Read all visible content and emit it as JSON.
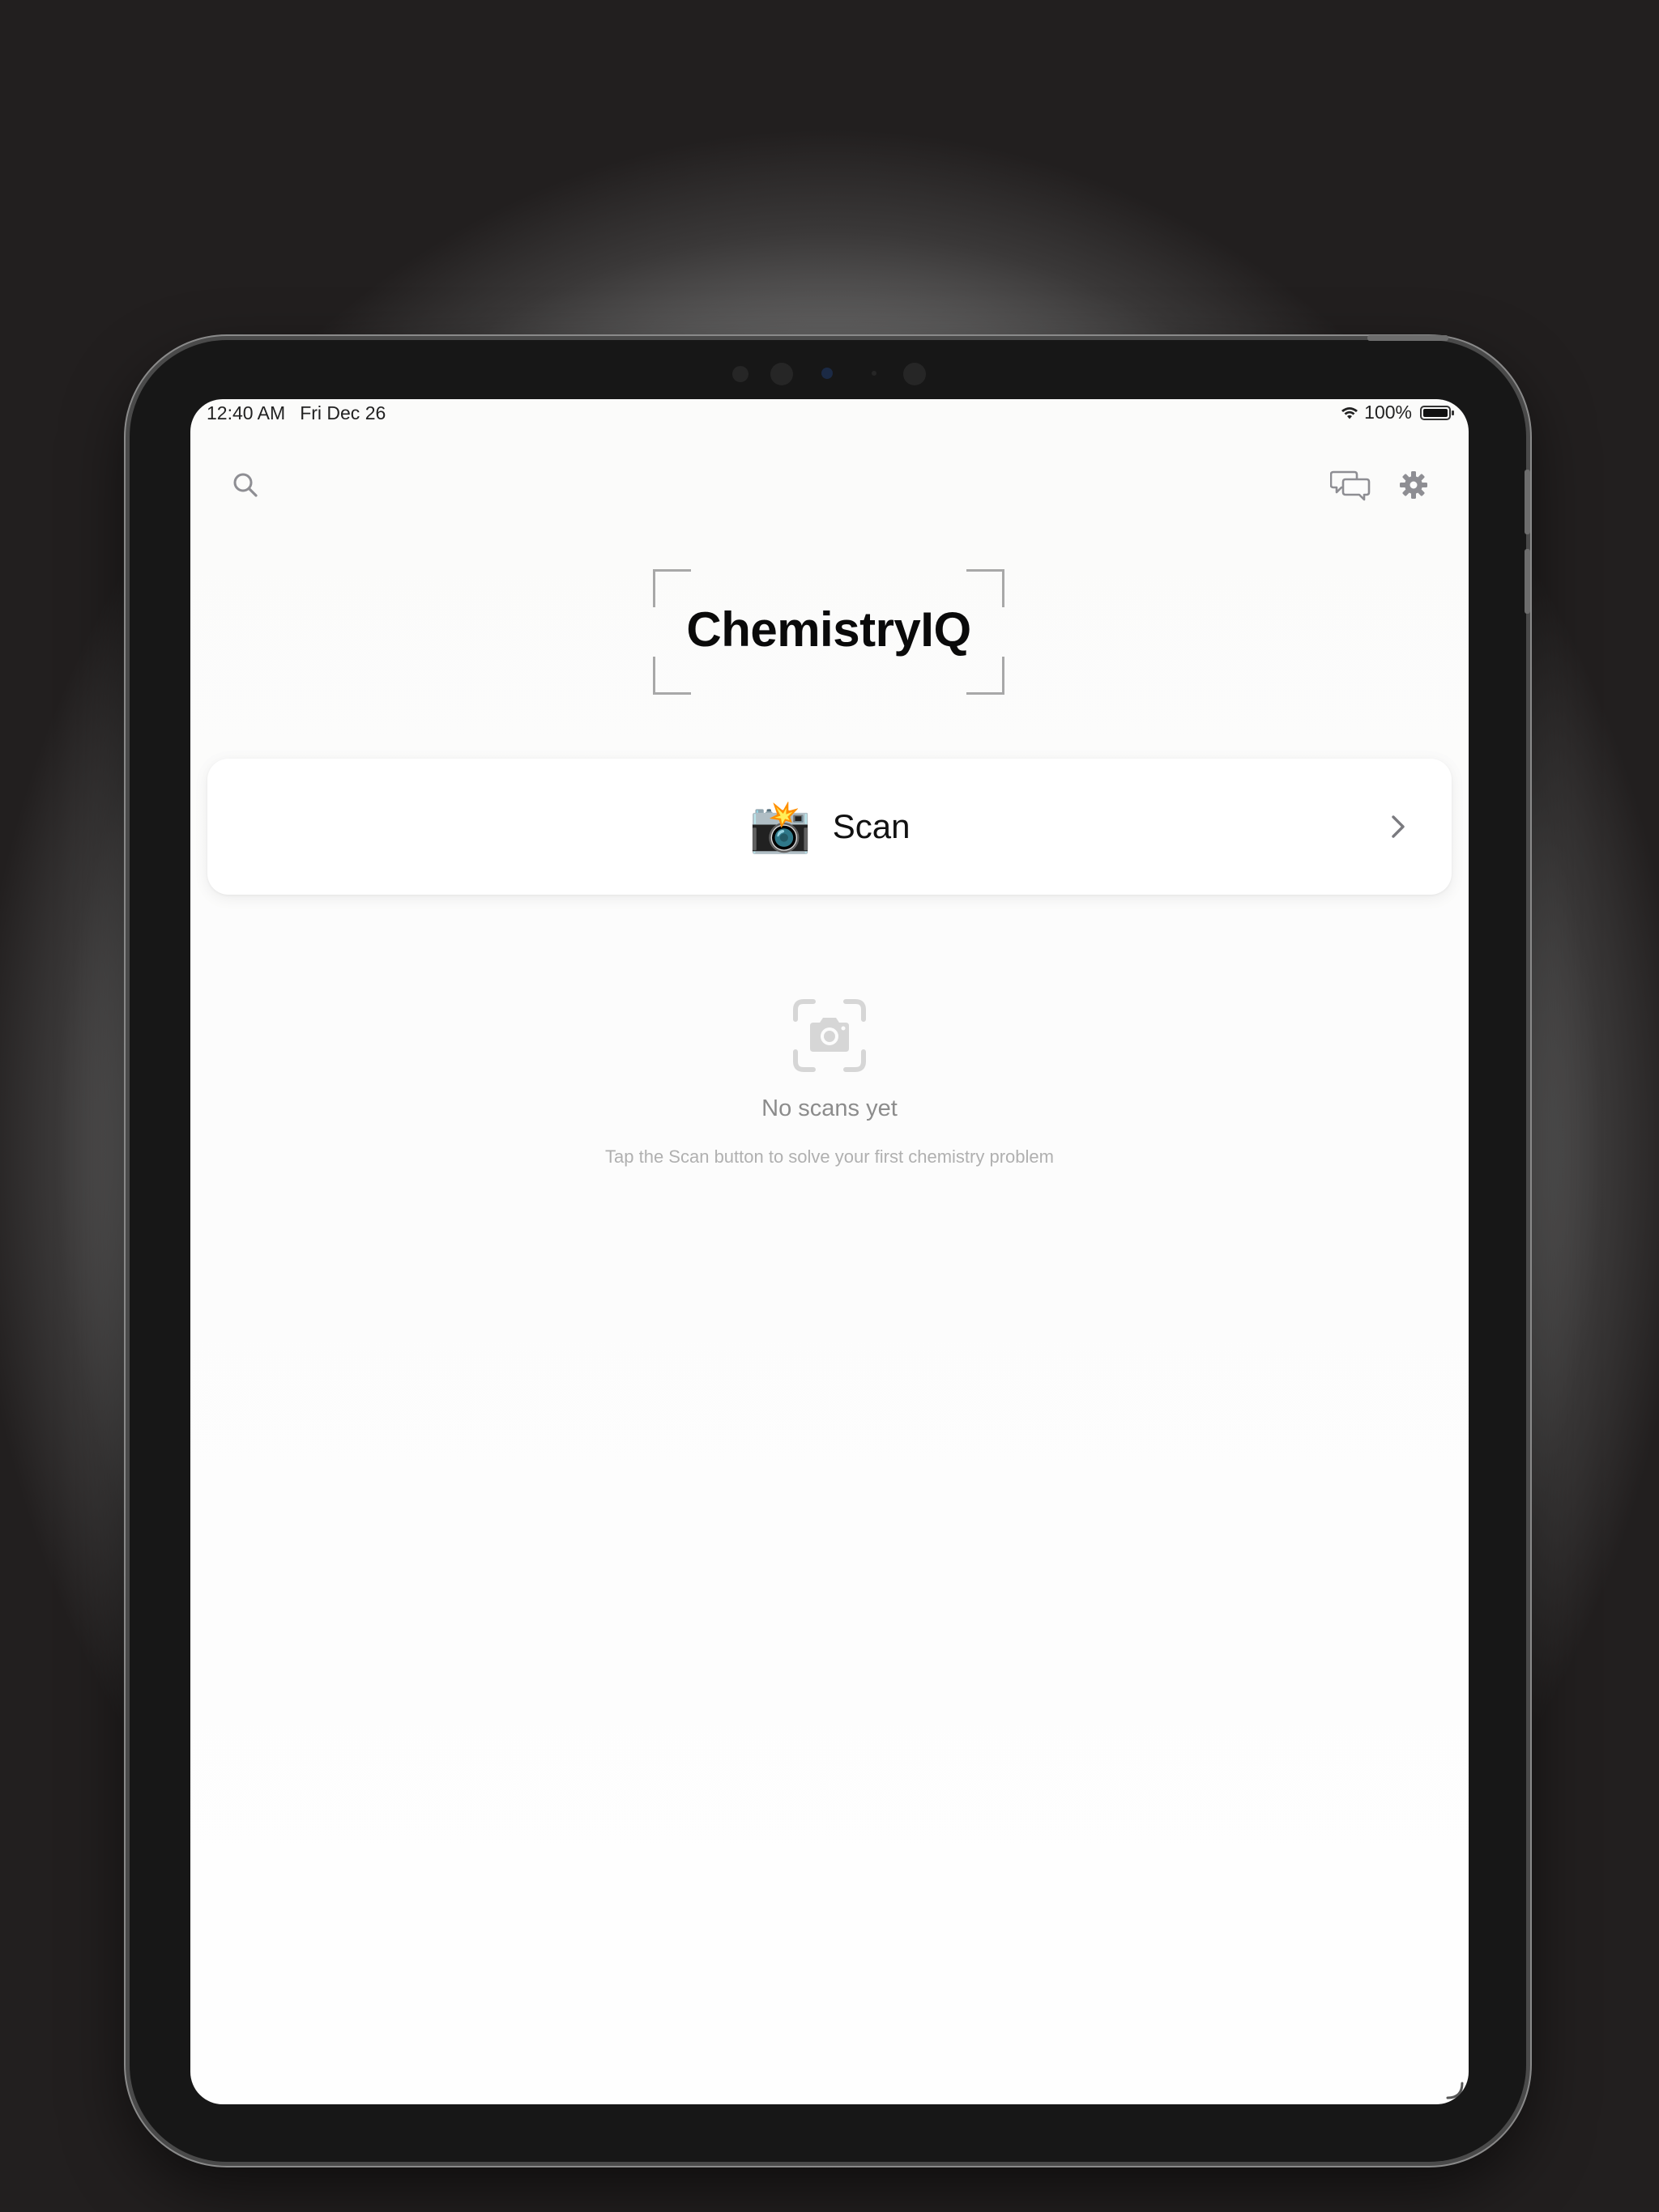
{
  "status_bar": {
    "time": "12:40 AM",
    "date": "Fri Dec 26",
    "battery": "100%",
    "battery_level": 1.0
  },
  "toolbar": {
    "search_icon": "search-icon",
    "chat_icon": "chat-bubbles-icon",
    "settings_icon": "gear-icon"
  },
  "header": {
    "app_title": "ChemistryIQ"
  },
  "scan_card": {
    "emoji": "📸",
    "label": "Scan",
    "chevron_icon": "chevron-right-icon"
  },
  "empty_state": {
    "icon": "camera-viewfinder-icon",
    "title": "No scans yet",
    "subtitle": "Tap the Scan button to solve your first chemistry problem"
  },
  "colors": {
    "background": "#fcfcfc",
    "card": "#ffffff",
    "icon_gray": "#8e8e93",
    "muted_text": "#8c8c8c"
  }
}
